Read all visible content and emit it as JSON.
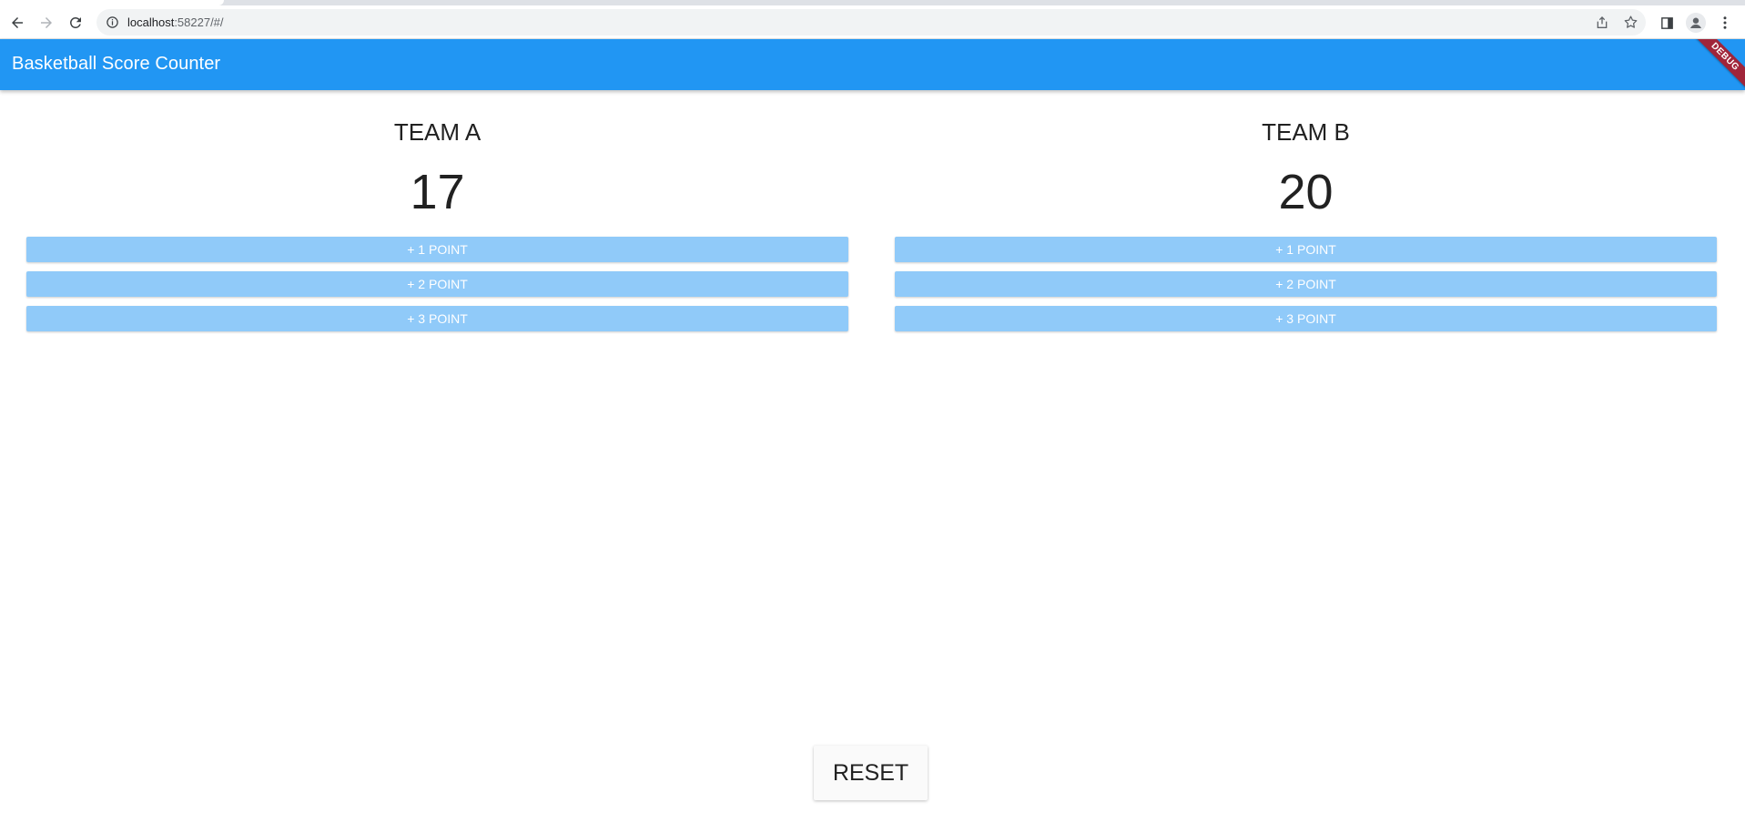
{
  "browser": {
    "url_host": "localhost",
    "url_path": ":58227/#/"
  },
  "app": {
    "title": "Basketball Score Counter",
    "debug_banner": "DEBUG",
    "appbar_color": "#2196f3",
    "button_color": "#90caf9"
  },
  "team_a": {
    "name": "TEAM A",
    "score": "17",
    "buttons": [
      "+ 1 POINT",
      "+ 2 POINT",
      "+ 3 POINT"
    ]
  },
  "team_b": {
    "name": "TEAM B",
    "score": "20",
    "buttons": [
      "+ 1 POINT",
      "+ 2 POINT",
      "+ 3 POINT"
    ]
  },
  "reset_label": "RESET"
}
